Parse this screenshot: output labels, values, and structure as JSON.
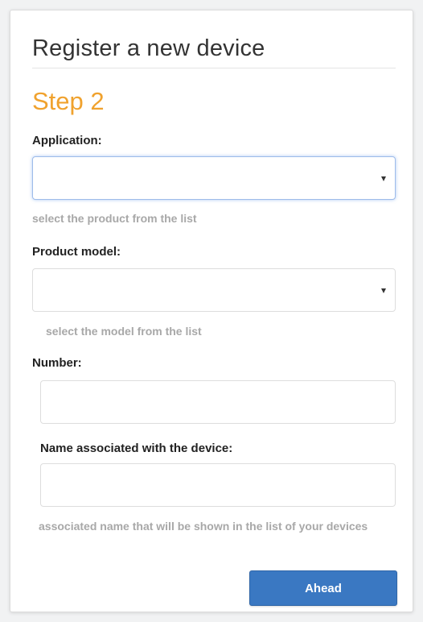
{
  "header": {
    "title": "Register a new device",
    "step": "Step 2"
  },
  "form": {
    "application": {
      "label": "Application:",
      "value": "",
      "help": "select the product from the list"
    },
    "product_model": {
      "label": "Product model:",
      "value": "",
      "help": "select the model from the list"
    },
    "number": {
      "label": "Number:",
      "value": ""
    },
    "device_name": {
      "label": "Name associated with the device:",
      "value": "",
      "help": "associated name that will be shown in the list of your devices"
    }
  },
  "actions": {
    "ahead_label": "Ahead"
  },
  "colors": {
    "accent_step": "#f0a22e",
    "primary_button": "#3a78c2",
    "help_text": "#a8a8a8"
  }
}
